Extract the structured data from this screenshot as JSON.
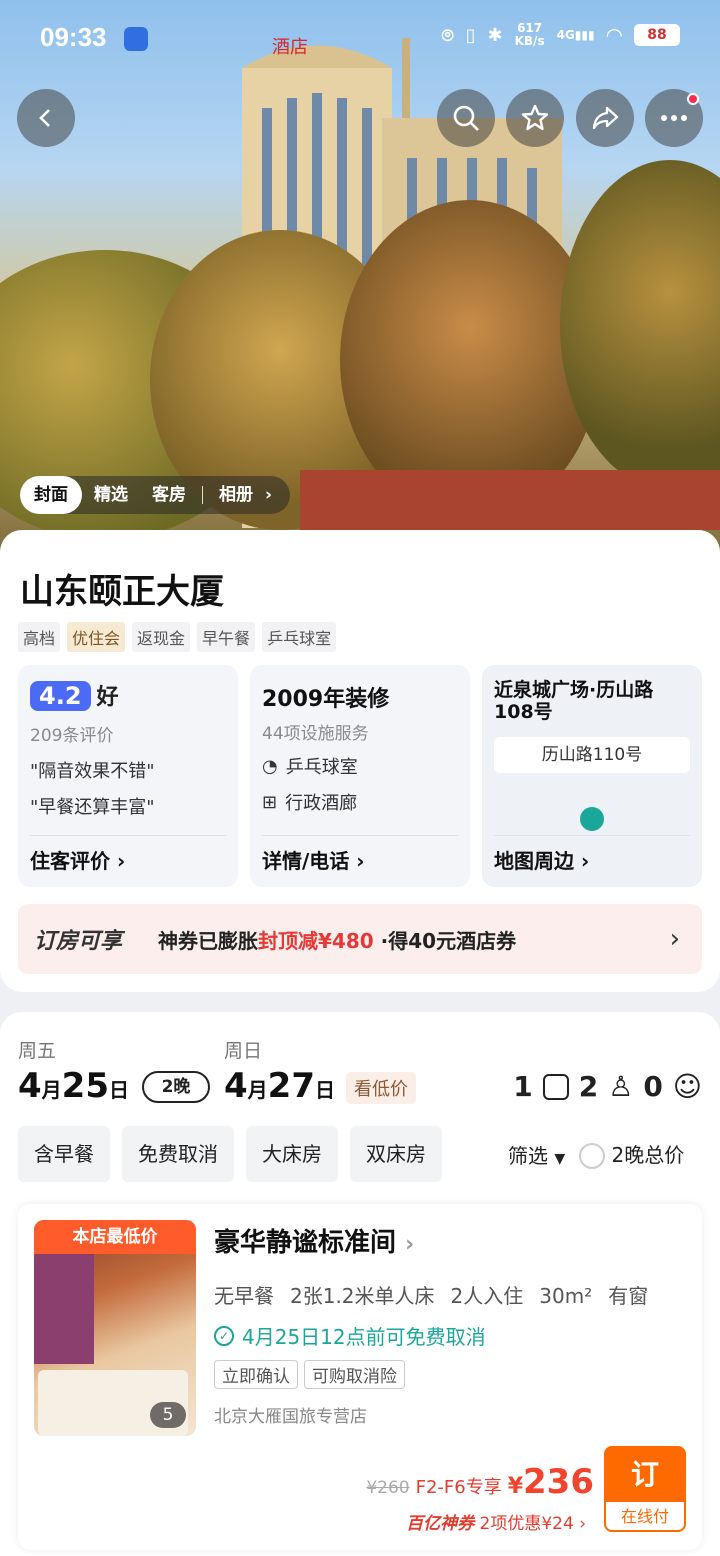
{
  "status_bar": {
    "time": "09:33",
    "net_speed": "617",
    "net_unit": "KB/s",
    "network": "4G",
    "battery": "88"
  },
  "gallery_tabs": [
    "封面",
    "精选",
    "客房",
    "相册"
  ],
  "hotel": {
    "name": "山东颐正大厦",
    "tags": [
      "高档",
      "优住会",
      "返现金",
      "早午餐",
      "乒乓球室"
    ]
  },
  "reviews": {
    "score": "4.2",
    "rating_word": "好",
    "count": "209条评价",
    "quotes": [
      "\"隔音效果不错\"",
      "\"早餐还算丰富\""
    ],
    "link": "住客评价"
  },
  "facilities": {
    "renovation": "2009年装修",
    "summary": "44项设施服务",
    "items": [
      "乒乓球室",
      "行政酒廊"
    ],
    "link": "详情/电话"
  },
  "location": {
    "title": "近泉城广场·历山路108号",
    "map_label": "历山路110号",
    "link": "地图周边"
  },
  "promo": {
    "title": "订房可享",
    "text_before": "神券已膨胀",
    "highlight": "封顶减¥480",
    "text_after": "·得40元酒店券"
  },
  "dates": {
    "checkin": {
      "weekday": "周五",
      "month": "4",
      "day": "25",
      "month_unit": "月",
      "day_unit": "日"
    },
    "checkout": {
      "weekday": "周日",
      "month": "4",
      "day": "27",
      "month_unit": "月",
      "day_unit": "日"
    },
    "nights": "2晚",
    "low_price": "看低价"
  },
  "guests": {
    "rooms": "1",
    "adults": "2",
    "children": "0"
  },
  "filters": [
    "含早餐",
    "免费取消",
    "大床房",
    "双床房"
  ],
  "filter_more": "筛选",
  "total_price_toggle": "2晚总价",
  "room": {
    "badge": "本店最低价",
    "image_count": "5",
    "name": "豪华静谧标准间",
    "specs": [
      "无早餐",
      "2张1.2米单人床",
      "2人入住",
      "30m²",
      "有窗"
    ],
    "cancel": "4月25日12点前可免费取消",
    "chips": [
      "立即确认",
      "可购取消险"
    ],
    "seller": "北京大雁国旅专营店",
    "original_price": "¥260",
    "member_tag": "F2-F6专享",
    "currency": "¥",
    "price": "236",
    "bonus_brand": "百亿神券",
    "bonus_text": "2项优惠¥24",
    "book_label": "订",
    "pay_label": "在线付"
  }
}
